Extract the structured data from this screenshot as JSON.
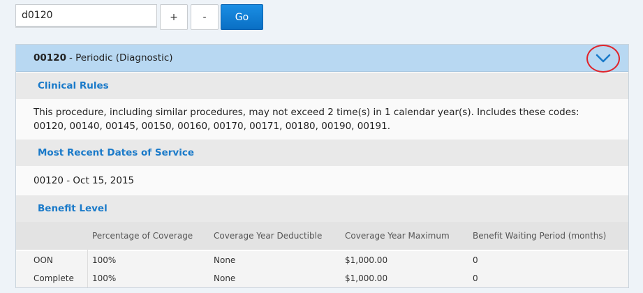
{
  "search": {
    "value": "d0120",
    "plus_label": "+",
    "minus_label": "-",
    "go_label": "Go"
  },
  "card": {
    "code": "00120",
    "separator": "- Periodic (Diagnostic)",
    "chevron_icon": "chevron-down-icon",
    "highlight_color": "#e0242b"
  },
  "clinical_rules": {
    "heading": "Clinical Rules",
    "text": "This procedure, including similar procedures, may not exceed 2 time(s) in 1 calendar year(s). Includes these codes: 00120, 00140, 00145, 00150, 00160, 00170, 00171, 00180, 00190, 00191."
  },
  "recent_dates": {
    "heading": "Most Recent Dates of Service",
    "entry": "00120 - Oct 15, 2015"
  },
  "benefit_level": {
    "heading": "Benefit Level",
    "columns": [
      "",
      "Percentage of Coverage",
      "Coverage Year Deductible",
      "Coverage Year Maximum",
      "Benefit Waiting Period (months)"
    ],
    "rows": [
      [
        "OON",
        "100%",
        "None",
        "$1,000.00",
        "0"
      ],
      [
        "Complete",
        "100%",
        "None",
        "$1,000.00",
        "0"
      ]
    ]
  },
  "colors": {
    "accent": "#1a7ac9",
    "header_bg": "#b8d8f2",
    "go_button": "#0a6fc4"
  }
}
